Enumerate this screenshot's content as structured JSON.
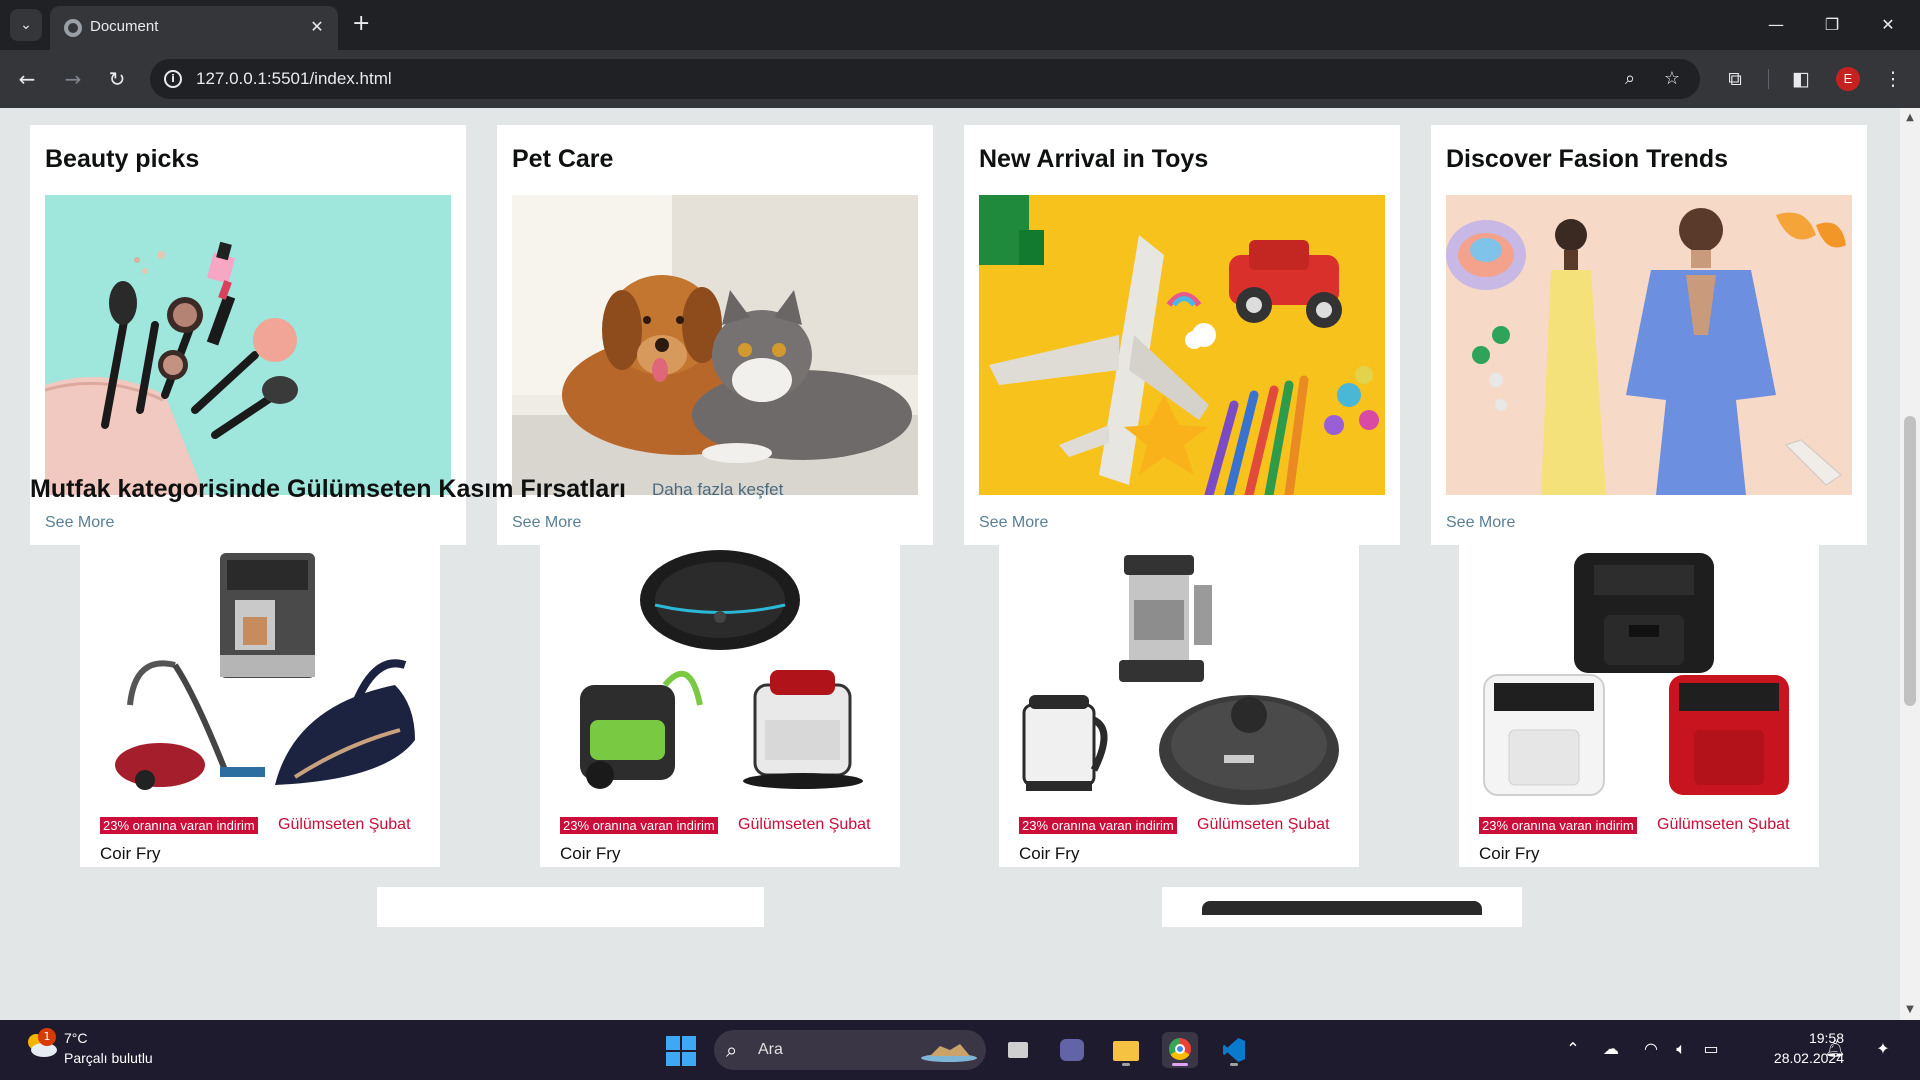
{
  "browser": {
    "tab_title": "Document",
    "url": "127.0.0.1:5501/index.html",
    "profile_initial": "E"
  },
  "categories": [
    {
      "title": "Beauty picks",
      "link": "See More",
      "image": "makeup-flatlay"
    },
    {
      "title": "Pet Care",
      "link": "See More",
      "image": "dog-and-cat"
    },
    {
      "title": "New Arrival in Toys",
      "link": "See More",
      "image": "toy-airplane-car-pencils"
    },
    {
      "title": "Discover Fasion Trends",
      "link": "See More",
      "image": "fashion-models"
    }
  ],
  "section": {
    "title": "Mutfak kategorisinde Gülümseten Kasım Fırsatları",
    "link": "Daha fazla keşfet"
  },
  "products": [
    {
      "badge": "23% oranına varan indirim",
      "deal": "Gülümseten Şubat",
      "name": "Coir Fry",
      "image": "coffee-machine-vacuum-iron"
    },
    {
      "badge": "23% oranına varan indirim",
      "deal": "Gülümseten Şubat",
      "name": "Coir Fry",
      "image": "robot-vacuum-carpet-cleaners"
    },
    {
      "badge": "23% oranına varan indirim",
      "deal": "Gülümseten Şubat",
      "name": "Coir Fry",
      "image": "espresso-kettle-robot-vacuum"
    },
    {
      "badge": "23% oranına varan indirim",
      "deal": "Gülümseten Şubat",
      "name": "Coir Fry",
      "image": "air-fryers"
    }
  ],
  "taskbar": {
    "weather_temp": "7°C",
    "weather_desc": "Parçalı bulutlu",
    "weather_badge": "1",
    "search_label": "Ara",
    "time": "19:58",
    "date": "28.02.2024"
  },
  "colors": {
    "deal_red": "#cc0c39",
    "link_blue": "#5a7f95",
    "page_bg": "#e3e6e6"
  }
}
